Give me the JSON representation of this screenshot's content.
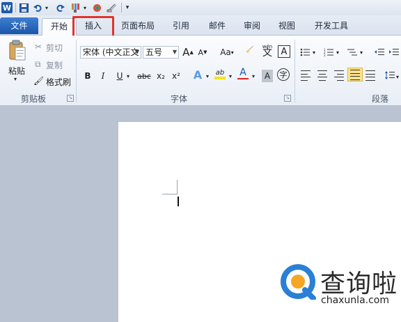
{
  "quick_access": {
    "app_badge": "W",
    "icons": [
      "save-icon",
      "undo-icon",
      "redo-icon",
      "format-painter-icon",
      "color-icon",
      "clear-icon",
      "customize-icon"
    ]
  },
  "tabs": [
    {
      "label": "文件"
    },
    {
      "label": "开始"
    },
    {
      "label": "插入"
    },
    {
      "label": "页面布局"
    },
    {
      "label": "引用"
    },
    {
      "label": "邮件"
    },
    {
      "label": "审阅"
    },
    {
      "label": "视图"
    },
    {
      "label": "开发工具"
    }
  ],
  "clipboard": {
    "paste_label": "粘贴",
    "cut_label": "剪切",
    "copy_label": "复制",
    "painter_label": "格式刷",
    "group_label": "剪贴板"
  },
  "font": {
    "family_value": "宋体 (中文正文",
    "size_value": "五号",
    "grow": "A",
    "shrink": "A",
    "case": "Aa",
    "bold": "B",
    "italic": "I",
    "underline": "U",
    "strike": "abc",
    "subscript": "x₂",
    "superscript": "x²",
    "text_effect": "A",
    "highlight": "ab",
    "font_color": "A",
    "char_shade": "A",
    "enclose": "字",
    "phonetic": "文",
    "phonetic_top": "wén",
    "char_border": "A",
    "group_label": "字体"
  },
  "paragraph": {
    "group_label": "段落"
  },
  "watermark": {
    "title": "查询啦",
    "domain": "chaxunla.com"
  },
  "colors": {
    "highlight_box": "#e0332f",
    "file_tab": "#2a66b8",
    "font_color_bar": "#e02020",
    "highlight_bar": "#f5e600"
  }
}
